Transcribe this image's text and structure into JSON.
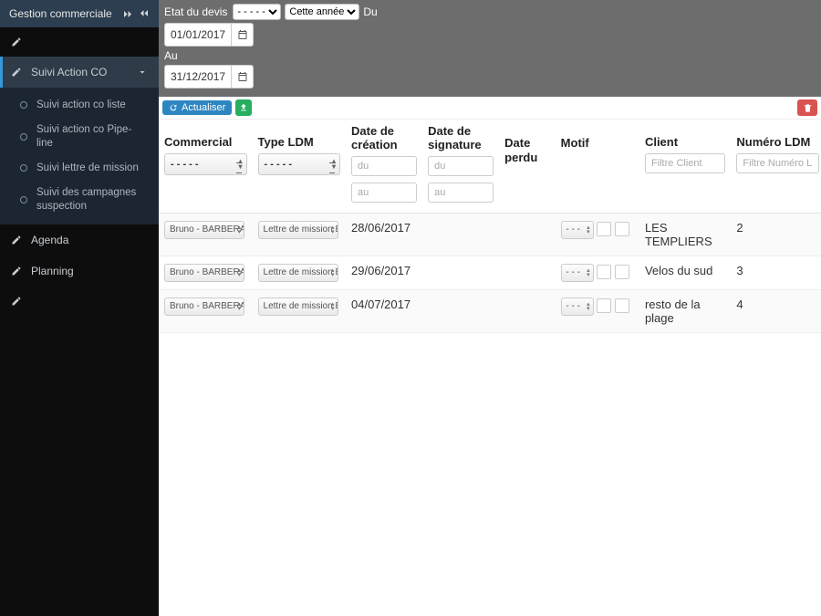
{
  "sidebar": {
    "title": "Gestion commerciale",
    "items": [
      {
        "icon": "edit",
        "label": ""
      },
      {
        "icon": "edit",
        "label": "Suivi Action CO",
        "active": true
      },
      {
        "icon": "edit",
        "label": "Agenda"
      },
      {
        "icon": "edit",
        "label": "Planning"
      },
      {
        "icon": "edit",
        "label": ""
      }
    ],
    "sub": [
      "Suivi action co liste",
      "Suivi action co Pipe-line",
      "Suivi lettre de mission",
      "Suivi des campagnes suspection"
    ]
  },
  "topbar": {
    "etat_label": "Etat du devis",
    "etat_value": "- - - - -",
    "period_value": "Cette année",
    "du_label": "Du",
    "du_value": "01/01/2017",
    "au_label": "Au",
    "au_value": "31/12/2017"
  },
  "buttons": {
    "refresh": "Actualiser"
  },
  "table": {
    "headers": {
      "commercial": "Commercial",
      "type_ldm": "Type LDM",
      "date_creation": "Date de création",
      "date_signature": "Date de signature",
      "date_perdu": "Date perdu",
      "motif": "Motif",
      "client": "Client",
      "numero_ldm": "Numéro LDM"
    },
    "filters": {
      "commercial": "- - - - -",
      "type_ldm": "- - - - -",
      "du_ph": "du",
      "au_ph": "au",
      "client_ph": "Filtre Client",
      "numero_ph": "Filtre Numéro LDM"
    },
    "rows": [
      {
        "commercial": "Bruno - BARBERA",
        "type": "Lettre de mission BN",
        "date_creation": "28/06/2017",
        "date_signature": "",
        "date_perdu": "- - -",
        "client": "LES TEMPLIERS",
        "numero": "2"
      },
      {
        "commercial": "Bruno - BARBERA",
        "type": "Lettre de mission BN",
        "date_creation": "29/06/2017",
        "date_signature": "",
        "date_perdu": "- - -",
        "client": "Velos du sud",
        "numero": "3"
      },
      {
        "commercial": "Bruno - BARBERA",
        "type": "Lettre de mission BN",
        "date_creation": "04/07/2017",
        "date_signature": "",
        "date_perdu": "- - -",
        "client": "resto de la plage",
        "numero": "4"
      }
    ]
  }
}
